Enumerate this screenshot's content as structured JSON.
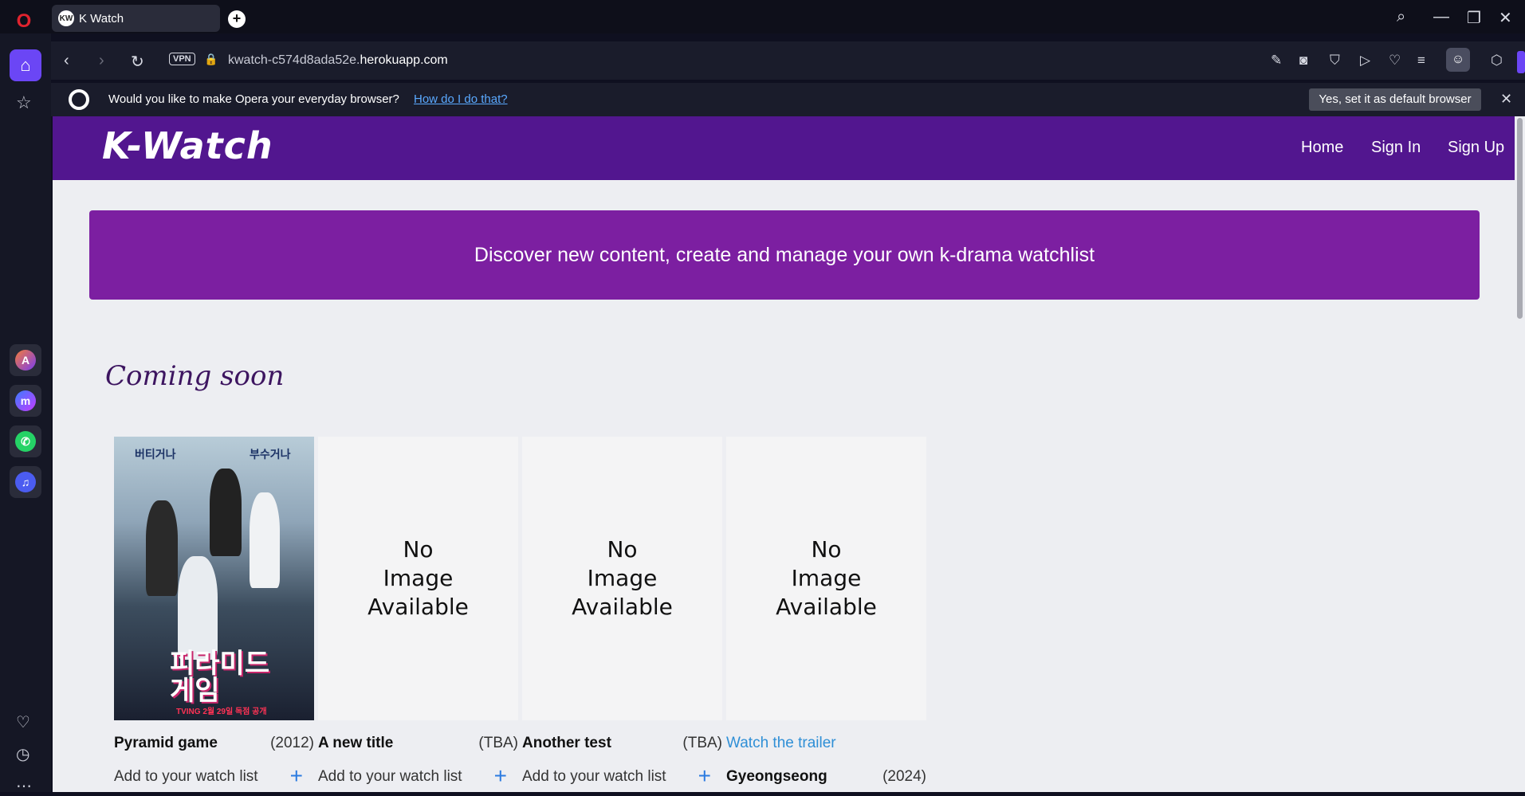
{
  "browser": {
    "tab_title": "K Watch",
    "tab_favicon": "KW",
    "url_prefix": "kwatch-c574d8ada52e.",
    "url_domain": "herokuapp.com",
    "vpn_label": "VPN",
    "infobar_message": "Would you like to make Opera your everyday browser?",
    "infobar_link": "How do I do that?",
    "infobar_button": "Yes, set it as default browser"
  },
  "site": {
    "brand": "K-Watch",
    "nav": [
      "Home",
      "Sign In",
      "Sign Up"
    ],
    "hero_text": "Discover new content, create and manage your own k-drama watchlist",
    "section_title": "Coming soon"
  },
  "cards": [
    {
      "title": "Pyramid game",
      "year": "(2012)",
      "add_label": "Add to your watch list",
      "poster_text_left": "버티거나",
      "poster_text_right": "부수거나",
      "poster_title_line1": "피라미드",
      "poster_title_line2": "게임",
      "poster_footer": "TVING 2월 29일 독점 공개"
    },
    {
      "title": "A new title",
      "year": "(TBA)",
      "add_label": "Add to your watch list",
      "no_image": [
        "No",
        "Image",
        "Available"
      ]
    },
    {
      "title": "Another test",
      "year": "(TBA)",
      "add_label": "Add to your watch list",
      "no_image": [
        "No",
        "Image",
        "Available"
      ]
    },
    {
      "trailer_label": "Watch the trailer",
      "title": "Gyeongseong",
      "year": "(2024)",
      "no_image": [
        "No",
        "Image",
        "Available"
      ]
    }
  ],
  "colors": {
    "navbar": "#52168f",
    "hero": "#7c1fa1",
    "section_title": "#3d1560",
    "link_blue": "#2f8fd6",
    "opera_accent": "#6b46f5"
  }
}
